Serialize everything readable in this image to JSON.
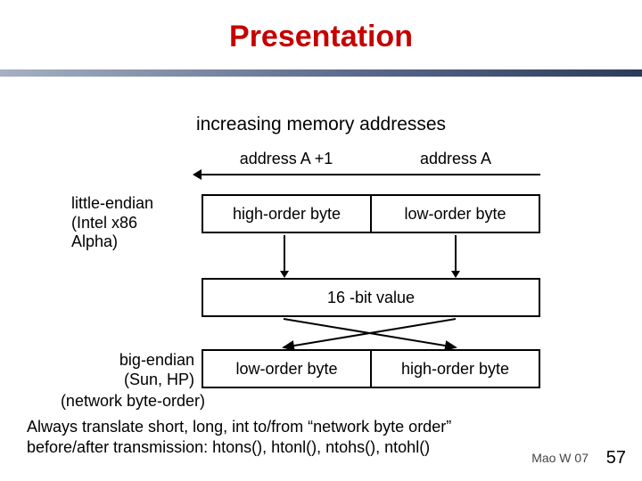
{
  "title": "Presentation",
  "increasing_label": "increasing memory addresses",
  "addr_labels": {
    "left": "address A +1",
    "right": "address A"
  },
  "little_endian": {
    "label": "little-endian\n(Intel x86\nAlpha)",
    "cell_left": "high-order byte",
    "cell_right": "low-order byte"
  },
  "middle_value": "16 -bit value",
  "big_endian": {
    "label": "big-endian\n(Sun, HP)",
    "network_label": "(network byte-order)",
    "cell_left": "low-order byte",
    "cell_right": "high-order byte"
  },
  "bottom_text": "Always translate short, long, int to/from “network byte order” before/after transmission: htons(), htonl(), ntohs(), ntohl()",
  "footer": {
    "author": "Mao W 07",
    "page": "57"
  }
}
